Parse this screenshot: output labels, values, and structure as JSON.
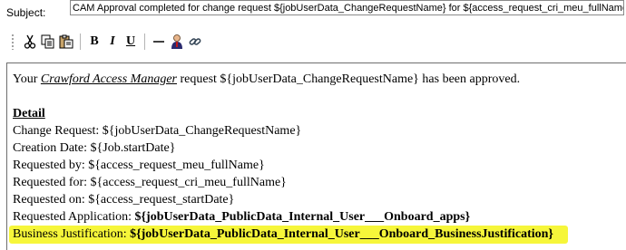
{
  "subject": {
    "label": "Subject:",
    "value": "CAM Approval completed for change request ${jobUserData_ChangeRequestName} for ${access_request_cri_meu_fullName}"
  },
  "toolbar": {
    "buttons": [
      {
        "name": "cut-icon",
        "glyph": "✂"
      },
      {
        "name": "copy-icon",
        "glyph": "⎘"
      },
      {
        "name": "paste-icon",
        "glyph": "📋"
      },
      {
        "name": "bold-button",
        "glyph": "B"
      },
      {
        "name": "italic-button",
        "glyph": "I"
      },
      {
        "name": "underline-button",
        "glyph": "U"
      },
      {
        "name": "horizontal-rule-icon",
        "glyph": "—"
      },
      {
        "name": "insert-person-icon",
        "glyph": "👤"
      },
      {
        "name": "insert-link-icon",
        "glyph": "🔗"
      }
    ]
  },
  "message": {
    "intro_prefix": "Your ",
    "intro_link": "Crawford Access Manager",
    "intro_suffix": " request ${jobUserData_ChangeRequestName} has been approved.",
    "detail_heading": "Detail",
    "change_request": "Change Request: ${jobUserData_ChangeRequestName}",
    "creation_date": "Creation Date: ${Job.startDate}",
    "requested_by": "Requested by: ${access_request_meu_fullName}",
    "requested_for": "Requested for: ${access_request_cri_meu_fullName}",
    "requested_on": "Requested on: ${access_request_startDate}",
    "requested_application_label": "Requested Application: ",
    "requested_application_value": "${jobUserData_PublicData_Internal_User___Onboard_apps}",
    "business_justification_label": "Business Justification: ",
    "business_justification_value": "${jobUserData_PublicData_Internal_User___Onboard_BusinessJustification}"
  },
  "colors": {
    "highlight": "#f6f63a"
  }
}
